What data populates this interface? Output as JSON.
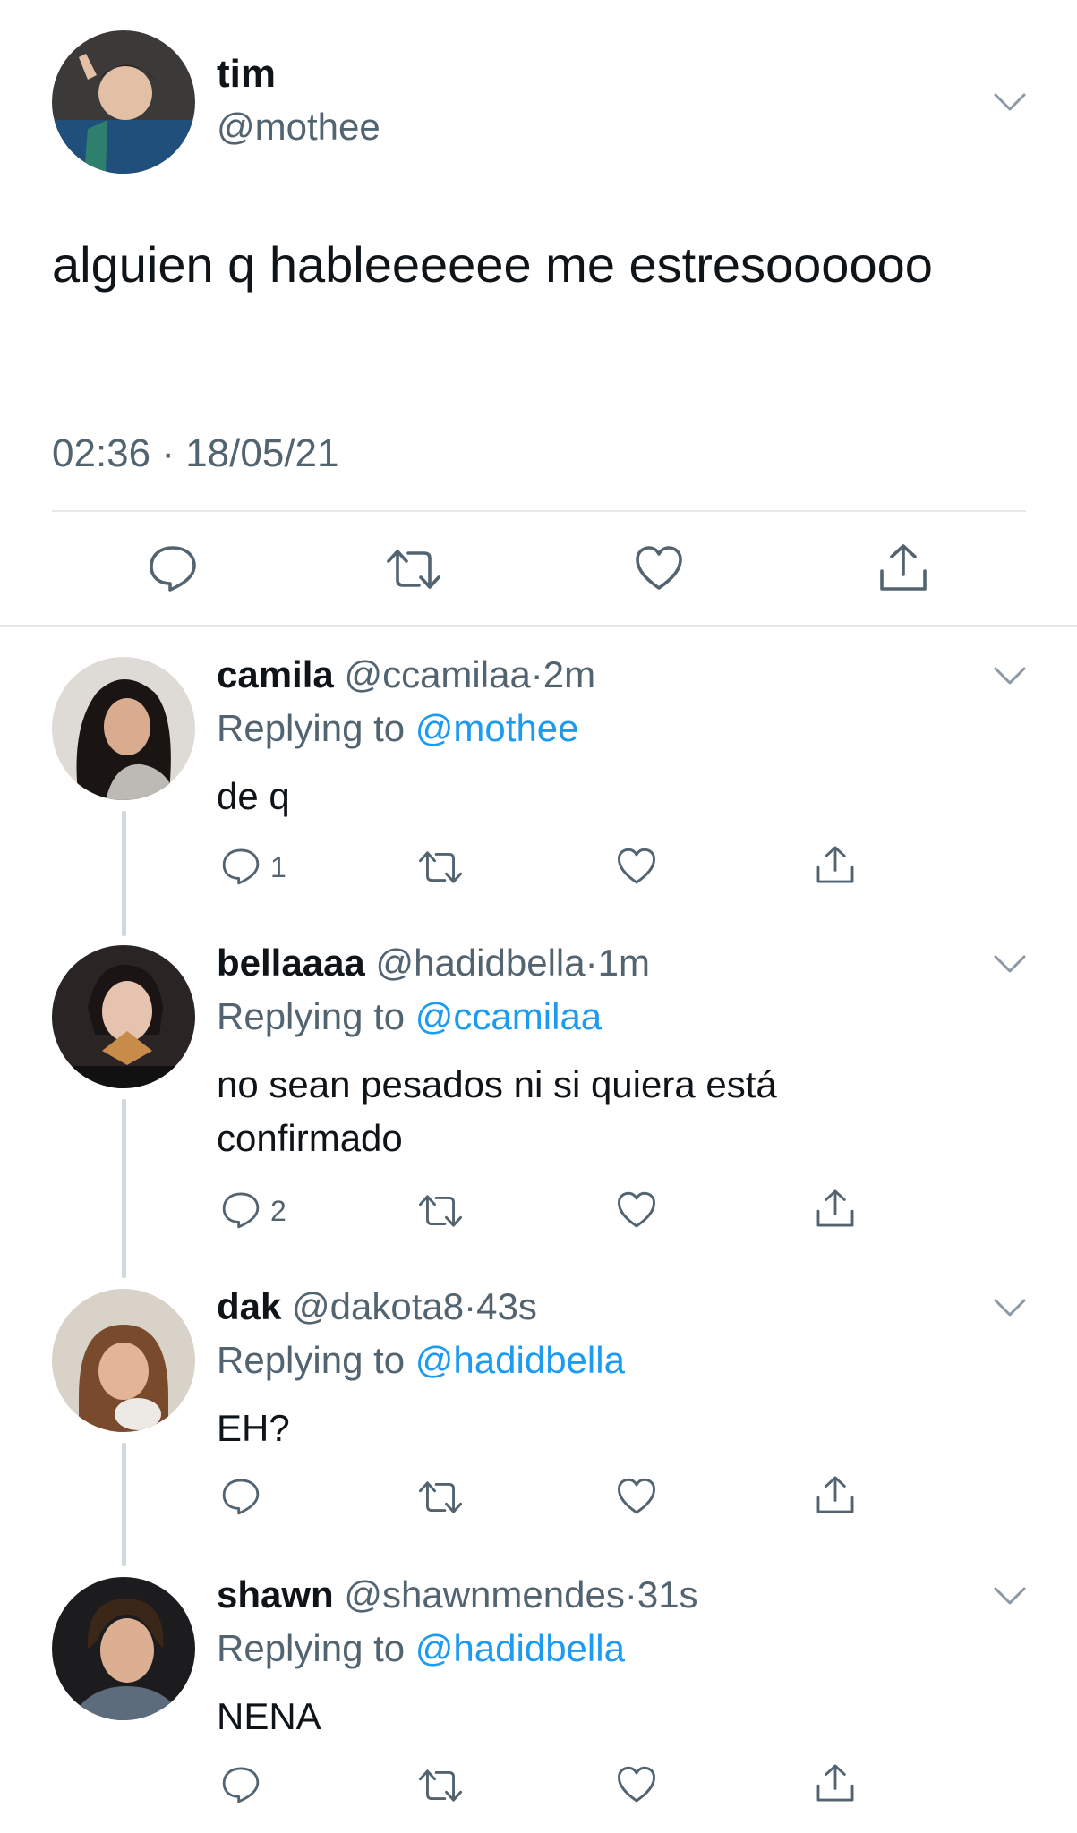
{
  "main_tweet": {
    "name": "tim",
    "handle": "@mothee",
    "text": "alguien q hableeeeee me estresoooooo",
    "timestamp": "02:36 · 18/05/21"
  },
  "replies": [
    {
      "name": "camila",
      "handle": "@ccamilaa",
      "time": "2m",
      "replying_label": "Replying to",
      "replying_to": "@mothee",
      "text": "de q",
      "reply_count": "1"
    },
    {
      "name": "bellaaaa",
      "handle": "@hadidbella",
      "time": "1m",
      "replying_label": "Replying to",
      "replying_to": "@ccamilaa",
      "text": "no sean pesados ni si quiera está confirmado",
      "reply_count": "2"
    },
    {
      "name": "dak",
      "handle": "@dakota8",
      "time": "43s",
      "replying_label": "Replying to",
      "replying_to": "@hadidbella",
      "text": "EH?",
      "reply_count": ""
    },
    {
      "name": "shawn",
      "handle": "@shawnmendes",
      "time": "31s",
      "replying_label": "Replying to",
      "replying_to": "@hadidbella",
      "text": "NENA",
      "reply_count": ""
    }
  ],
  "separator": "·",
  "icons": {
    "reply": "reply-icon",
    "retweet": "retweet-icon",
    "like": "heart-icon",
    "share": "share-icon",
    "menu": "chevron-down-icon"
  },
  "colors": {
    "link": "#1d9bf0",
    "secondary_text": "#536471",
    "icon": "#536471"
  }
}
